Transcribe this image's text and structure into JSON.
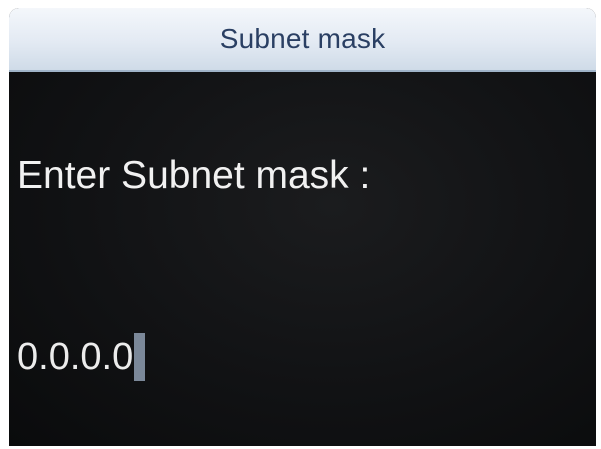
{
  "title_bar": {
    "title": "Subnet mask"
  },
  "prompt": {
    "label": "Enter Subnet mask :"
  },
  "input": {
    "value": "0.0.0.0"
  },
  "colors": {
    "title_bar_background": "#e3eaf3",
    "title_text": "#2a3f63",
    "screen_background": "#111214",
    "text": "#f1f1f1",
    "cursor": "#7b8899"
  }
}
